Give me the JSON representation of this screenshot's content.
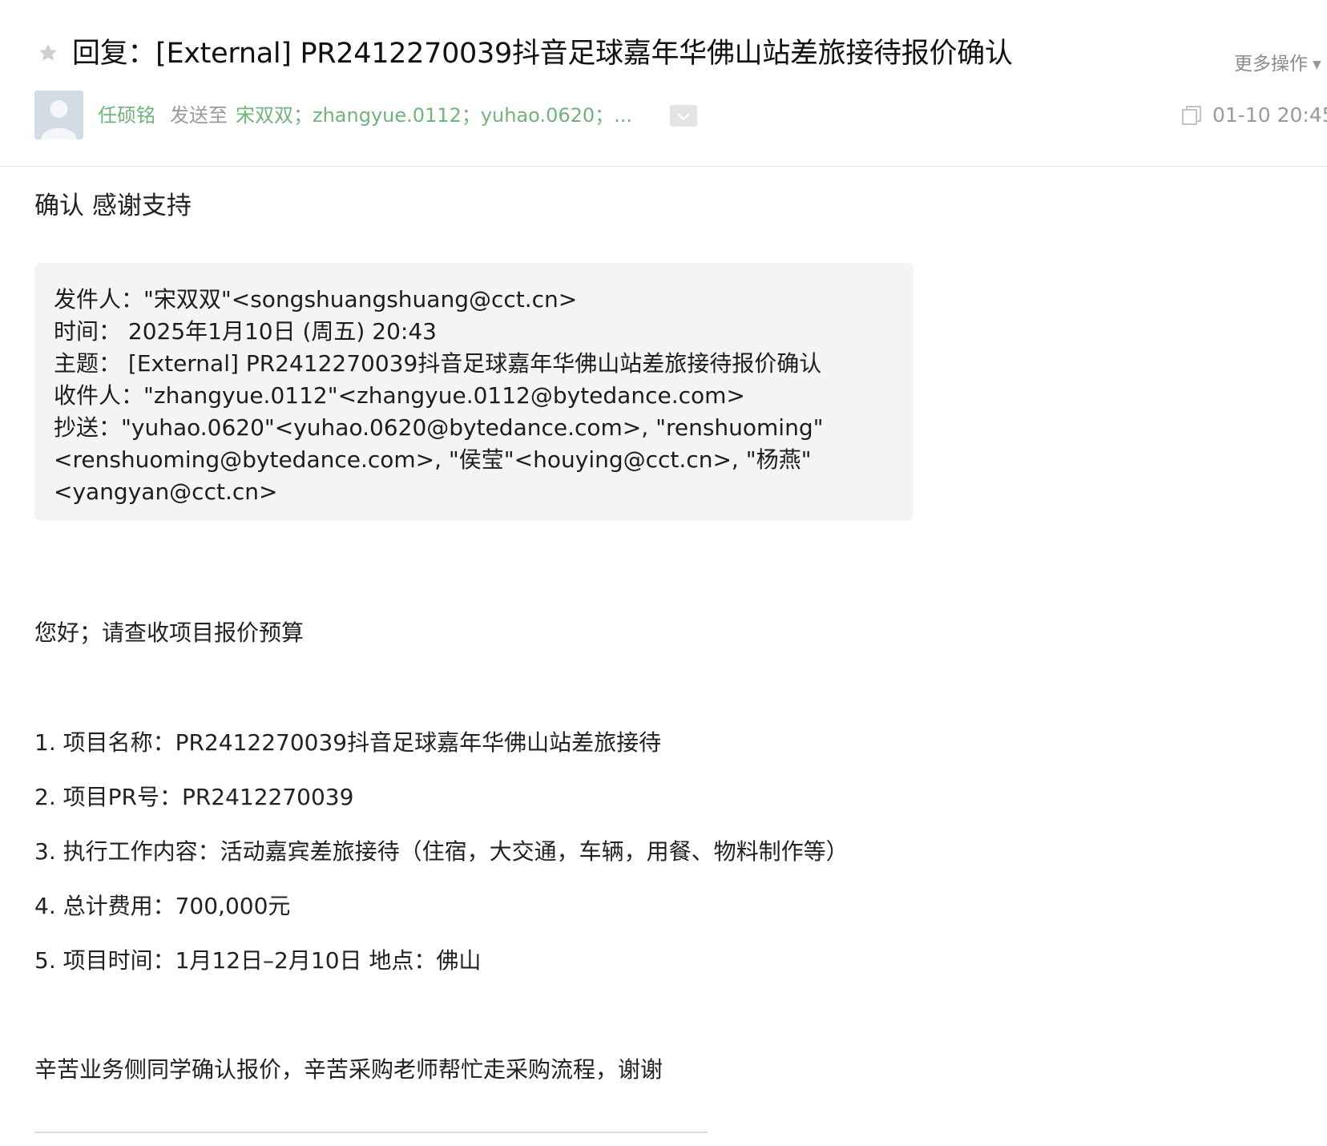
{
  "header": {
    "subject": "回复：[External] PR2412270039抖音足球嘉年华佛山站差旅接待报价确认",
    "more_actions": "更多操作",
    "sender_name": "任硕铭",
    "sent_to_label": "发送至",
    "recipients": "宋双双；zhangyue.0112；yuhao.0620；...",
    "datetime": "01-10 20:45"
  },
  "body": {
    "reply_text": "确认 感谢支持",
    "quote_lines": [
      "发件人：\"宋双双\"<songshuangshuang@cct.cn>",
      "时间：  2025年1月10日 (周五) 20:43",
      "主题：  [External] PR2412270039抖音足球嘉年华佛山站差旅接待报价确认",
      "收件人：\"zhangyue.0112\"<zhangyue.0112@bytedance.com>",
      "抄送：\"yuhao.0620\"<yuhao.0620@bytedance.com>, \"renshuoming\"",
      "<renshuoming@bytedance.com>, \"侯莹\"<houying@cct.cn>, \"杨燕\"",
      "<yangyan@cct.cn>"
    ],
    "greeting": "您好；请查收项目报价预算",
    "items": [
      "1.  项目名称：PR2412270039抖音足球嘉年华佛山站差旅接待",
      "2. 项目PR号：PR2412270039",
      "3. 执行工作内容：活动嘉宾差旅接待（住宿，大交通，车辆，用餐、物料制作等）",
      "4. 总计费用：700,000元",
      "5. 项目时间：1月12日–2月10日    地点：佛山"
    ],
    "closing": "辛苦业务侧同学确认报价，辛苦采购老师帮忙走采购流程，谢谢"
  },
  "icons": {
    "star": "star-icon",
    "avatar": "default-avatar-icon",
    "expand": "check-dropdown-icon",
    "window": "new-window-icon",
    "more_caret": "caret-down-icon"
  },
  "colors": {
    "sender_green": "#6fb47b",
    "muted_gray": "#9a9a9a",
    "quote_bg": "#f3f4f6"
  }
}
